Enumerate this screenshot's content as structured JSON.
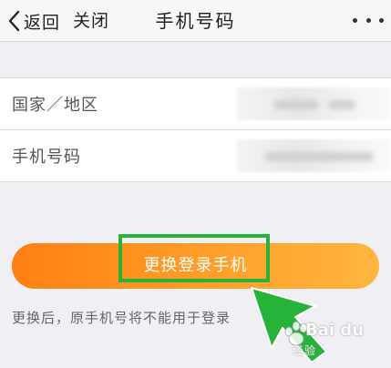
{
  "navbar": {
    "back_label": "返回",
    "close_label": "关闭",
    "title": "手机号码",
    "more_icon": "more-dots-icon"
  },
  "form": {
    "rows": [
      {
        "label": "国家／地区",
        "value": ""
      },
      {
        "label": "手机号码",
        "value": ""
      }
    ]
  },
  "actions": {
    "change_phone_label": "更换登录手机"
  },
  "hint": {
    "text": "更换后，原手机号将不能用于登录"
  },
  "annotation": {
    "highlight_color": "#27b23a",
    "arrow_color": "#27b23a"
  },
  "watermark": {
    "brand": "Bai du",
    "sub": "经验"
  },
  "colors": {
    "button_start": "#ff7f13",
    "button_end": "#ffb640",
    "background": "#efeff4"
  }
}
